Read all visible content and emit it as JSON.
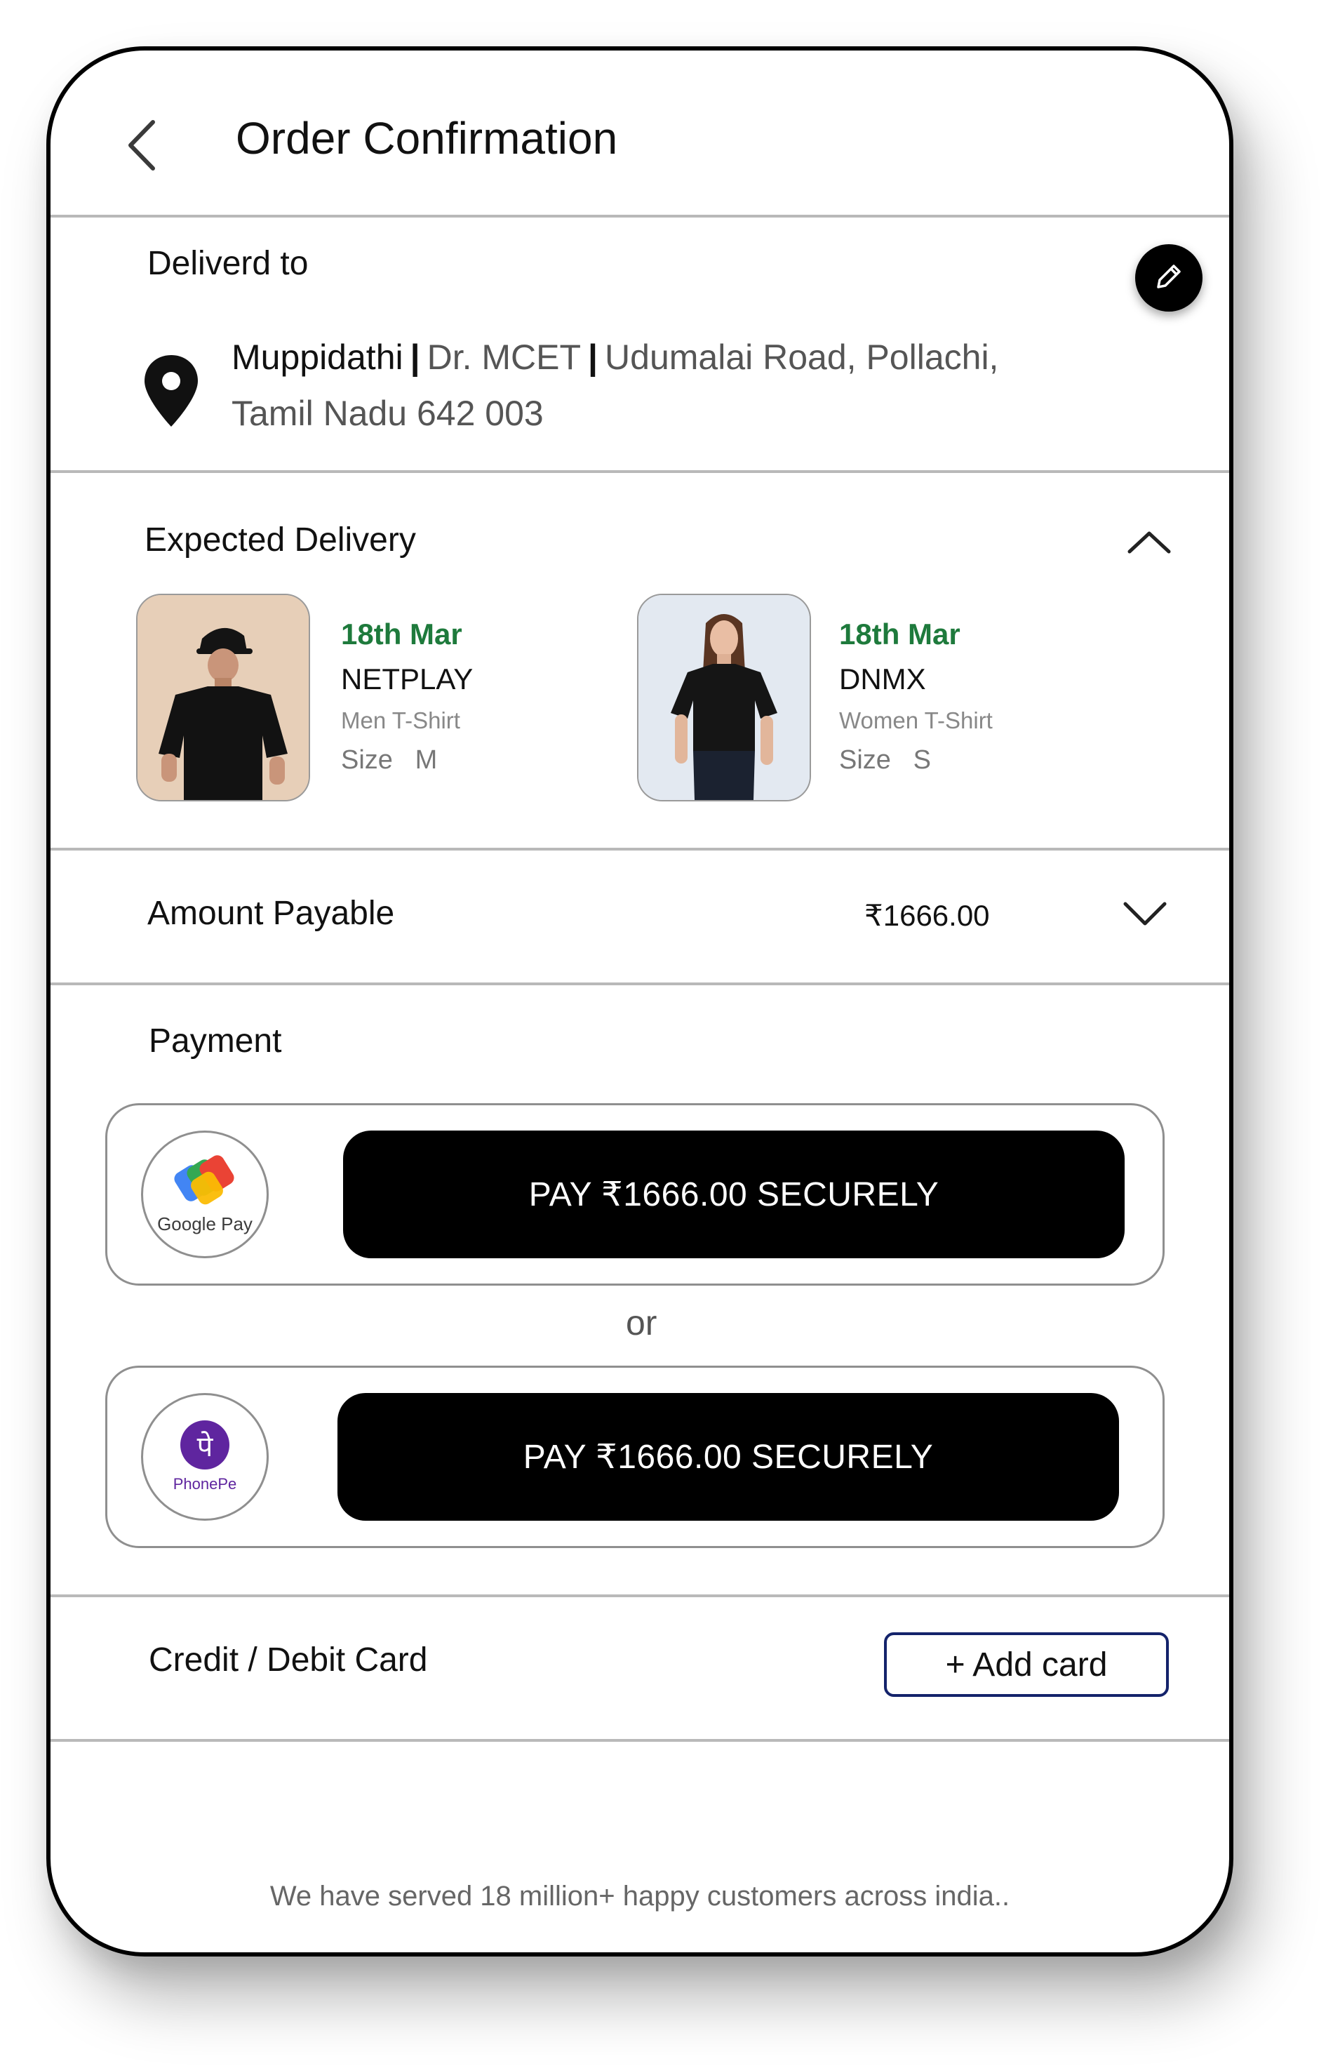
{
  "header": {
    "title": "Order Confirmation",
    "back_icon": "chevron-left-icon"
  },
  "delivered_to": {
    "label": "Deliverd to",
    "edit_icon": "pencil-icon",
    "location_icon": "map-pin-icon",
    "name": "Muppidathi",
    "place": "Dr. MCET",
    "road": "Udumalai Road, Pollachi,",
    "state_pin": "Tamil Nadu 642 003"
  },
  "expected_delivery": {
    "label": "Expected Delivery",
    "toggle_icon": "chevron-up-icon",
    "items": [
      {
        "date": "18th Mar",
        "brand": "NETPLAY",
        "type": "Men T-Shirt",
        "size_label": "Size",
        "size": "M"
      },
      {
        "date": "18th Mar",
        "brand": "DNMX",
        "type": "Women T-Shirt",
        "size_label": "Size",
        "size": "S"
      }
    ]
  },
  "amount_payable": {
    "label": "Amount Payable",
    "value": "₹1666.00",
    "toggle_icon": "chevron-down-icon"
  },
  "payment": {
    "label": "Payment",
    "options": [
      {
        "provider": "Google Pay",
        "logo_text": "Google Pay",
        "button_label": "PAY ₹1666.00 SECURELY"
      },
      {
        "provider": "PhonePe",
        "logo_text": "PhonePe",
        "logo_glyph": "पे",
        "button_label": "PAY ₹1666.00 SECURELY"
      }
    ],
    "separator": "or"
  },
  "card": {
    "label": "Credit / Debit Card",
    "add_button": "+ Add card"
  },
  "footer": {
    "note": "We have served 18 million+ happy customers across india.."
  },
  "colors": {
    "accent_green": "#1e7a3c",
    "add_card_border": "#14236b",
    "phonepe_purple": "#5f259f",
    "button_black": "#000000"
  }
}
